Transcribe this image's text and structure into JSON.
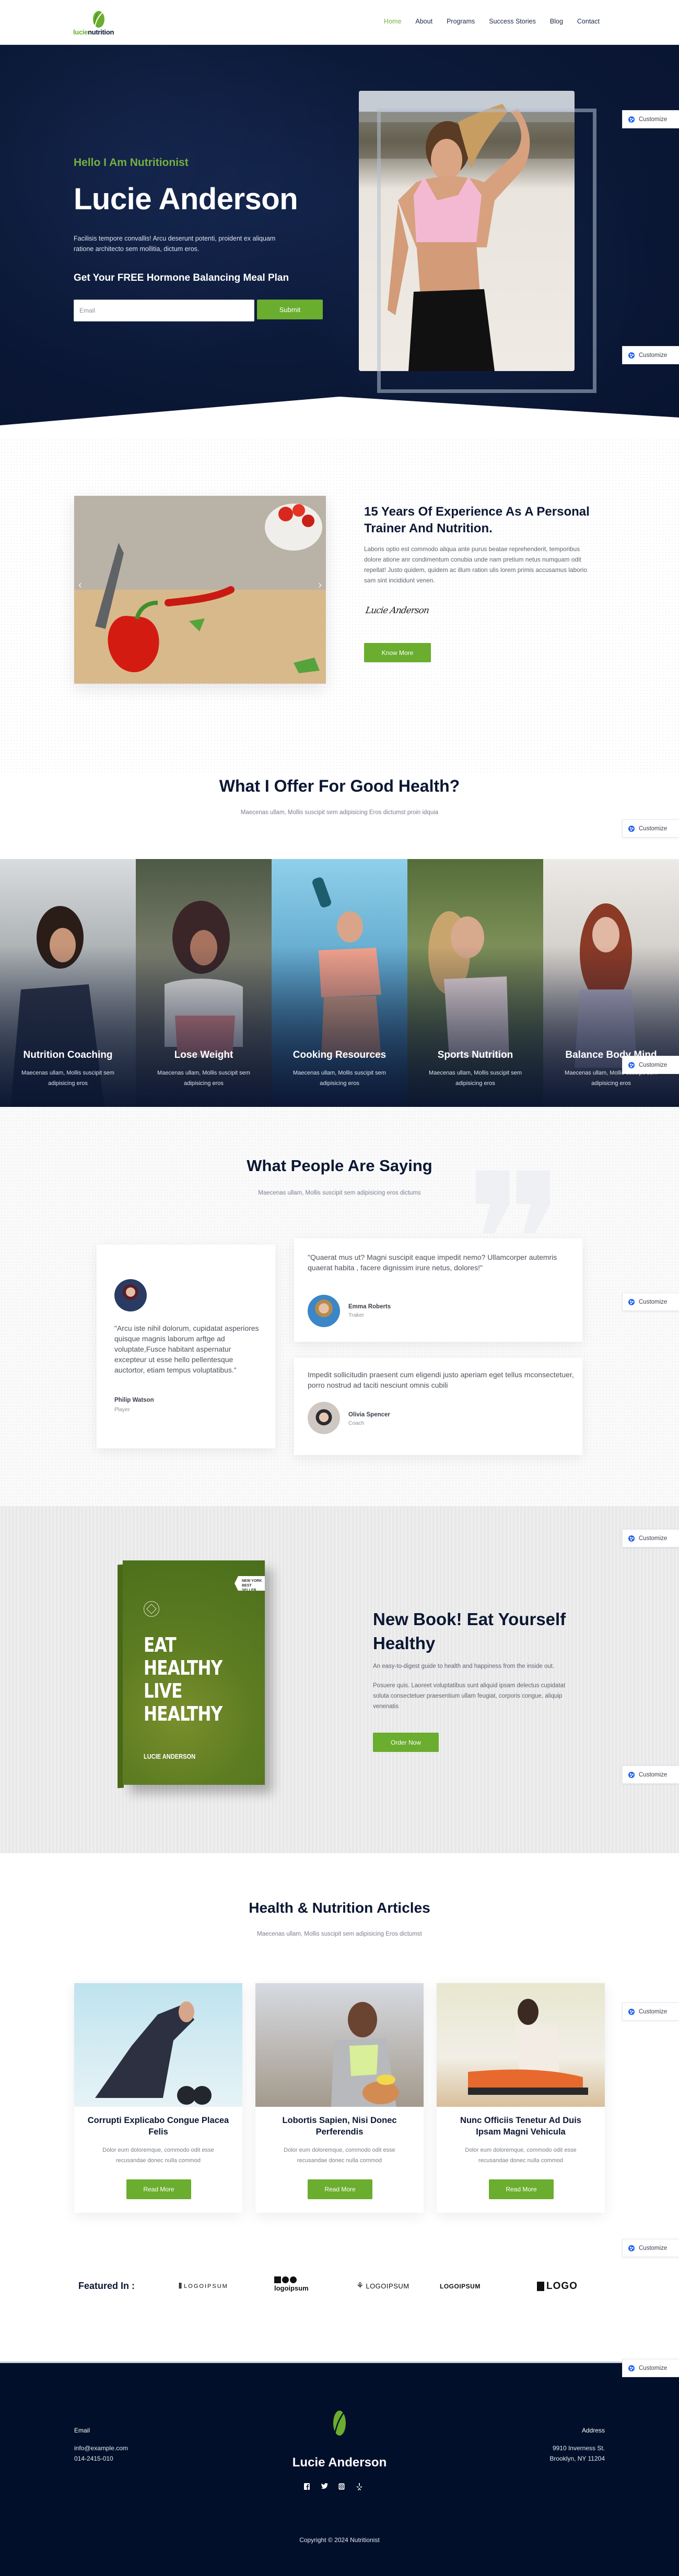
{
  "header": {
    "logo": {
      "part1": "lucie",
      "part2": "nutrition"
    },
    "nav": [
      {
        "label": "Home",
        "active": true
      },
      {
        "label": "About",
        "active": false
      },
      {
        "label": "Programs",
        "active": false
      },
      {
        "label": "Success Stories",
        "active": false
      },
      {
        "label": "Blog",
        "active": false
      },
      {
        "label": "Contact",
        "active": false
      }
    ]
  },
  "hero": {
    "subtitle": "Hello I Am Nutritionist",
    "title": "Lucie Anderson",
    "description": "Facilisis tempore convallis! Arcu deserunt potenti, proident ex aliquam ratione architecto sem mollitia, dictum eros.",
    "cta_heading": "Get Your FREE Hormone Balancing Meal Plan",
    "email_placeholder": "Email",
    "submit_label": "Submit"
  },
  "customize_label": "Customize",
  "about": {
    "title": "15 Years Of Experience As A Personal Trainer And Nutrition.",
    "text": "Laboris optio est commodo aliqua ante purus beatae reprehenderit, temporibus dolore atione anr condimentum conubia unde nam pretium netus numquam odit repellat! Justo quidem, quidem ac illum ration ulis lorem primis accusamus laborio sam sint incididunt venen.",
    "signature": "Lucie Anderson",
    "button": "Know More",
    "prev_arrow": "‹",
    "next_arrow": "›"
  },
  "services": {
    "title": "What I Offer For Good Health?",
    "subtitle": "Maecenas ullam, Mollis suscipit sem adipisicing Eros dictumst proin idquia",
    "items": [
      {
        "title": "Nutrition Coaching",
        "desc": "Maecenas ullam, Mollis suscipit sem adipisicing eros"
      },
      {
        "title": "Lose Weight",
        "desc": "Maecenas ullam, Mollis suscipit sem adipisicing eros"
      },
      {
        "title": "Cooking Resources",
        "desc": "Maecenas ullam, Mollis suscipit sem adipisicing eros"
      },
      {
        "title": "Sports Nutrition",
        "desc": "Maecenas ullam, Mollis suscipit sem adipisicing eros"
      },
      {
        "title": "Balance Body Mind",
        "desc": "Maecenas ullam, Mollis suscipit sem adipisicing eros"
      }
    ]
  },
  "testimonials": {
    "title": "What People Are Saying",
    "subtitle": "Maecenas ullam, Mollis suscipit sem adipisicing eros dictums",
    "items": [
      {
        "quote": "\"Arcu iste nihil dolorum, cupidatat asperiores quisque magnis laborum arftge ad voluptate,Fusce habitant aspernatur excepteur ut esse hello pellentesque auctortor, etiam tempus voluptatibus.\"",
        "name": "Philip Watson",
        "role": "Player"
      },
      {
        "quote": "\"Quaerat mus ut? Magni suscipit eaque impedit nemo? Ullamcorper autemris quaerat habita , facere dignissim irure netus, dolores!\"",
        "name": "Emma Roberts",
        "role": "Traker"
      },
      {
        "quote": "Impedit sollicitudin praesent cum eligendi justo aperiam eget tellus mconsectetuer, porro nostrud ad taciti nesciunt omnis cubili",
        "name": "Olivia Spencer",
        "role": "Coach"
      }
    ]
  },
  "book": {
    "cover_badge_line1": "NEW YORK",
    "cover_badge_line2": "BEST SELLER",
    "cover_title": "EAT HEALTHY LIVE HEALTHY",
    "cover_author": "LUCIE ANDERSON",
    "title": "New Book! Eat Yourself Healthy",
    "tagline": "An easy-to-digest guide to health and happiness from the inside out.",
    "text": "Posuere quis. Laoreet voluptatibus sunt aliquid ipsam delectus cupidatat soluta consectetuer praesentium ullam feugiat, corporis congue, aliquip venenatis",
    "button": "Order Now"
  },
  "articles": {
    "title": "Health & Nutrition Articles",
    "subtitle": "Maecenas ullam, Mollis suscipit sem adipisicing Eros dictumst",
    "items": [
      {
        "title": "Corrupti Explicabo Congue Placea Felis",
        "desc": "Dolor eum doloremque, commodo odit esse recusandae donec nulla commod",
        "button": "Read More"
      },
      {
        "title": "Lobortis Sapien, Nisi Donec Perferendis",
        "desc": "Dolor eum doloremque, commodo odit esse recusandae donec nulla commod",
        "button": "Read More"
      },
      {
        "title": "Nunc Officiis Tenetur Ad Duis Ipsam Magni Vehicula",
        "desc": "Dolor eum doloremque, commodo odit esse recusandae donec nulla commod",
        "button": "Read More"
      }
    ]
  },
  "featured": {
    "label": "Featured In :",
    "brands": [
      "LOGOIPSUM",
      "logoipsum",
      "LOGOIPSUM",
      "LOGOIPSUM",
      "LOGO"
    ]
  },
  "footer": {
    "email_label": "Email",
    "email": "info@example.com",
    "phone": "014-2415-010",
    "name": "Lucie Anderson",
    "address_label": "Address",
    "address_line1": "9910 Inverness St.",
    "address_line2": "Brooklyn, NY 11204",
    "social": [
      "facebook",
      "twitter",
      "instagram",
      "yelp"
    ],
    "copyright": "Copyright © 2024 Nutritionist"
  },
  "colors": {
    "brand_green": "#6aad2f",
    "navy": "#0b1733",
    "footer_bg": "#010f2a"
  }
}
